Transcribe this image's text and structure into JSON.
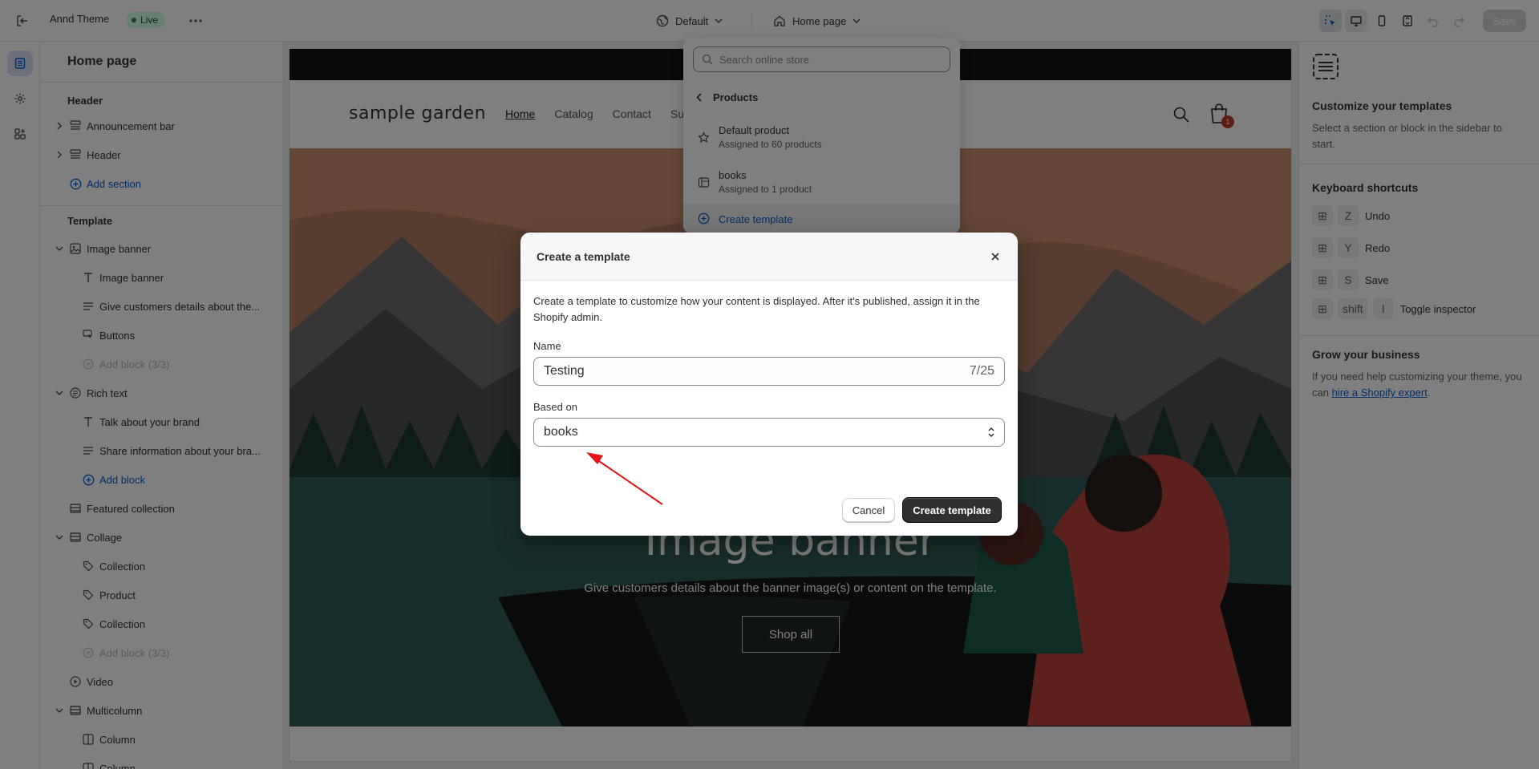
{
  "topbar": {
    "theme_name": "Annd Theme",
    "live_badge": "Live",
    "theme_selector": "Default",
    "page_selector": "Home page",
    "save_label": "Save"
  },
  "sidebar": {
    "title": "Home page",
    "header_group": "Header",
    "header_items": [
      "Announcement bar",
      "Header"
    ],
    "add_section": "Add section",
    "template_group": "Template",
    "image_banner": {
      "label": "Image banner",
      "blocks": [
        "Image banner",
        "Give customers details about the...",
        "Buttons"
      ],
      "add_block": "Add block (3/3)"
    },
    "rich_text": {
      "label": "Rich text",
      "blocks": [
        "Talk about your brand",
        "Share information about your bra..."
      ],
      "add_block": "Add block"
    },
    "featured_collection": "Featured collection",
    "collage": {
      "label": "Collage",
      "blocks": [
        "Collection",
        "Product",
        "Collection"
      ],
      "add_block": "Add block (3/3)"
    },
    "video": "Video",
    "multicolumn": {
      "label": "Multicolumn",
      "blocks": [
        "Column",
        "Column"
      ]
    }
  },
  "preview": {
    "logo": "sample garden",
    "nav": [
      "Home",
      "Catalog",
      "Contact",
      "Su"
    ],
    "cart_count": "1",
    "banner_title": "Image banner",
    "banner_subtitle": "Give customers details about the banner image(s) or content on the template.",
    "banner_button": "Shop all"
  },
  "popover": {
    "search_placeholder": "Search online store",
    "back_label": "Products",
    "items": [
      {
        "title": "Default product",
        "subtitle": "Assigned to 60 products"
      },
      {
        "title": "books",
        "subtitle": "Assigned to 1 product"
      }
    ],
    "create_label": "Create template"
  },
  "modal": {
    "title": "Create a template",
    "description": "Create a template to customize how your content is displayed. After it's published, assign it in the Shopify admin.",
    "name_label": "Name",
    "name_value": "Testing",
    "name_counter": "7/25",
    "based_on_label": "Based on",
    "based_on_value": "books",
    "cancel_label": "Cancel",
    "create_label": "Create template"
  },
  "right_panel": {
    "title": "Customize your templates",
    "intro": "Select a section or block in the sidebar to start.",
    "shortcuts_title": "Keyboard shortcuts",
    "shortcuts": [
      {
        "keys": [
          "⊞",
          "Z"
        ],
        "label": "Undo"
      },
      {
        "keys": [
          "⊞",
          "Y"
        ],
        "label": "Redo"
      },
      {
        "keys": [
          "⊞",
          "S"
        ],
        "label": "Save"
      },
      {
        "keys": [
          "⊞",
          "shift",
          "I"
        ],
        "label": "Toggle inspector"
      }
    ],
    "grow_title": "Grow your business",
    "grow_text_prefix": "If you need help customizing your theme, you can ",
    "grow_link": "hire a Shopify expert",
    "grow_text_suffix": "."
  },
  "colors": {
    "accent_link": "#005bd3",
    "live_green": "#29845a",
    "primary_button": "#303030",
    "annotation_arrow": "#e8131a"
  }
}
